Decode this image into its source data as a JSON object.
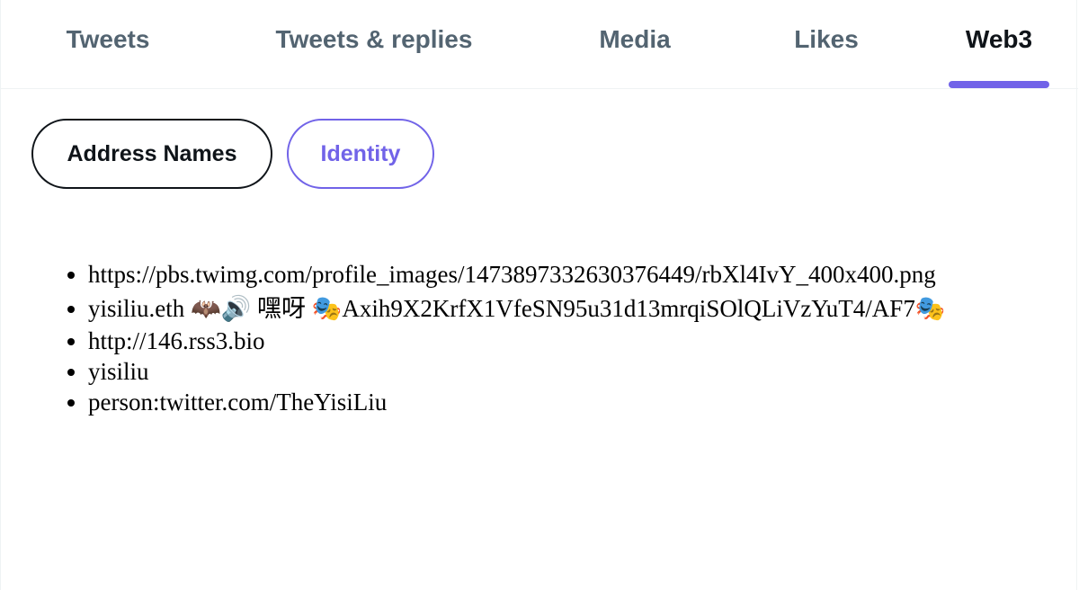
{
  "tabs": [
    {
      "label": "Tweets",
      "active": false
    },
    {
      "label": "Tweets & replies",
      "active": false
    },
    {
      "label": "Media",
      "active": false
    },
    {
      "label": "Likes",
      "active": false
    },
    {
      "label": "Web3",
      "active": true
    }
  ],
  "subtabs": {
    "address_names": "Address Names",
    "identity": "Identity",
    "selected": "Identity"
  },
  "identity_items": [
    "https://pbs.twimg.com/profile_images/1473897332630376449/rbXl4IvY_400x400.png",
    "yisiliu.eth 🦇🔊 嘿呀 🎭Axih9X2KrfX1VfeSN95u31d13mrqiSOlQLiVzYuT4/AF7🎭",
    "http://146.rss3.bio",
    "yisiliu",
    "person:twitter.com/TheYisiLiu"
  ],
  "colors": {
    "accent": "#7163e8",
    "text_primary": "#0f1419",
    "text_secondary": "#536471",
    "divider": "#eff3f4"
  }
}
